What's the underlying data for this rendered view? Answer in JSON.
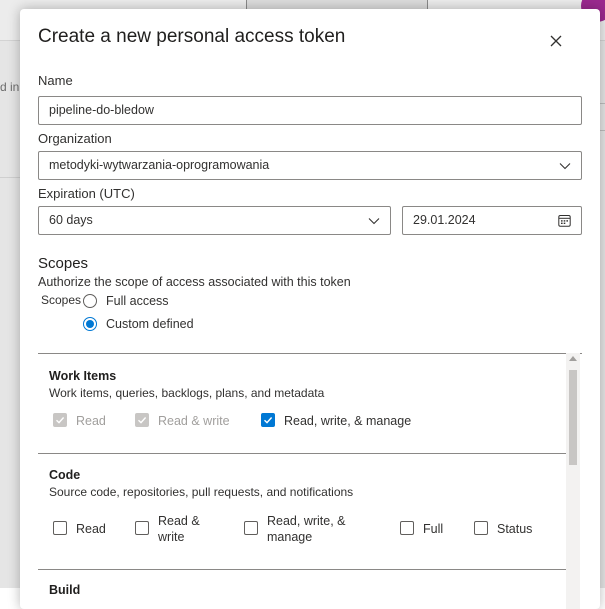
{
  "background": {
    "partial_text": "d in"
  },
  "dialog": {
    "title": "Create a new personal access token",
    "close_icon": "close-icon"
  },
  "name": {
    "label": "Name",
    "value": "pipeline-do-bledow"
  },
  "organization": {
    "label": "Organization",
    "value": "metodyki-wytwarzania-oprogramowania",
    "icon": "chevron-down-icon"
  },
  "expiration": {
    "label": "Expiration (UTC)",
    "value": "60 days",
    "date": "29.01.2024",
    "icon": "calendar-icon"
  },
  "scopes": {
    "heading": "Scopes",
    "description": "Authorize the scope of access associated with this token",
    "label": "Scopes",
    "options": [
      {
        "label": "Full access",
        "selected": false
      },
      {
        "label": "Custom defined",
        "selected": true
      }
    ]
  },
  "sections": [
    {
      "title": "Work Items",
      "description": "Work items, queries, backlogs, plans, and metadata",
      "options": [
        {
          "label": "Read",
          "state": "checked-disabled"
        },
        {
          "label": "Read & write",
          "state": "checked-disabled"
        },
        {
          "label": "Read, write, & manage",
          "state": "checked"
        }
      ]
    },
    {
      "title": "Code",
      "description": "Source code, repositories, pull requests, and notifications",
      "options": [
        {
          "label": "Read",
          "state": "unchecked"
        },
        {
          "label1": "Read &",
          "label2": "write",
          "state": "unchecked"
        },
        {
          "label1": "Read, write, &",
          "label2": "manage",
          "state": "unchecked"
        },
        {
          "label": "Full",
          "state": "unchecked"
        },
        {
          "label": "Status",
          "state": "unchecked"
        }
      ]
    },
    {
      "title": "Build"
    }
  ],
  "colors": {
    "accent": "#0078d4",
    "border": "#8a8886",
    "text": "#323130",
    "disabled": "#c8c6c4"
  }
}
